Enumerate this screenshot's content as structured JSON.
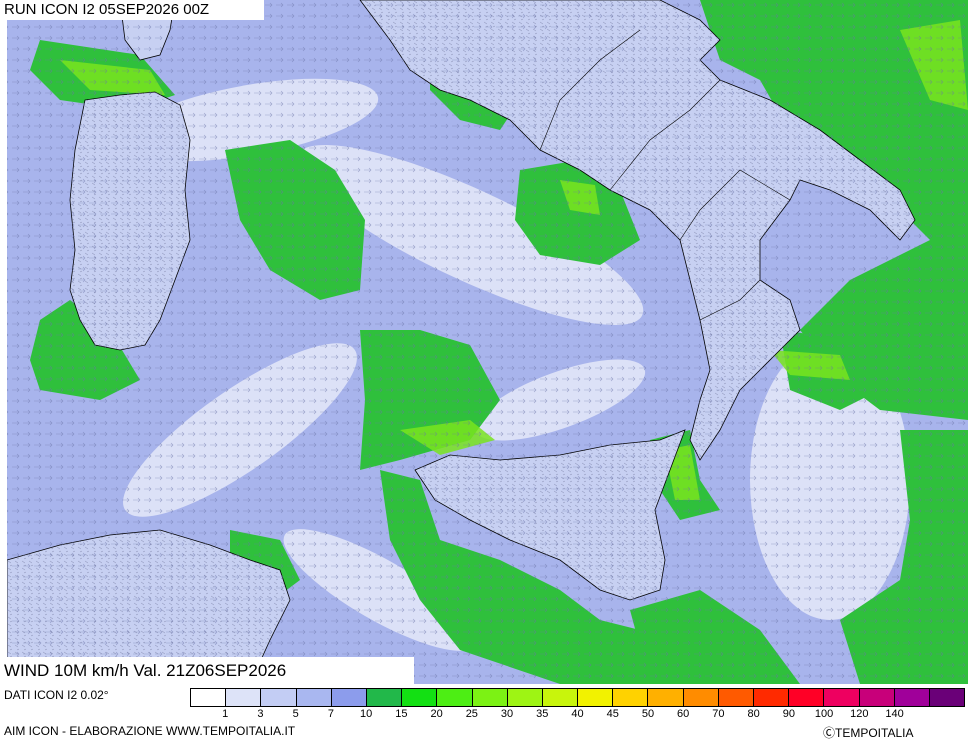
{
  "header": {
    "run_label": "RUN ICON I2 05SEP2026 00Z"
  },
  "map": {
    "variable_label": "WIND 10M km/h Val. 21Z06SEP2026",
    "colors": {
      "sea_base": "#a8b4ec",
      "land_base": "#c7d0f2",
      "calm": "#eef0fb",
      "green_wind": "#2fc03c",
      "lime_wind": "#79e41e",
      "coast": "#000000"
    }
  },
  "footer": {
    "dati": "DATI ICON I2 0.02°",
    "aim": "AIM ICON - ELABORAZIONE WWW.TEMPOITALIA.IT",
    "credit": "ⒸTEMPOITALIA"
  },
  "legend": {
    "colors": [
      "#ffffff",
      "#dde3f8",
      "#c3cdf4",
      "#a9b7f0",
      "#8c9cec",
      "#22b84a",
      "#13e013",
      "#4dee14",
      "#7cf214",
      "#9ef414",
      "#c8f50c",
      "#f2f200",
      "#ffd200",
      "#ffb000",
      "#ff8c00",
      "#ff5a00",
      "#ff2a00",
      "#ff0026",
      "#ee0060",
      "#c8007a",
      "#a0009a",
      "#6a0078"
    ],
    "ticks": [
      "1",
      "3",
      "5",
      "7",
      "10",
      "15",
      "20",
      "25",
      "30",
      "35",
      "40",
      "45",
      "50",
      "60",
      "70",
      "80",
      "90",
      "100",
      "120",
      "140"
    ]
  }
}
